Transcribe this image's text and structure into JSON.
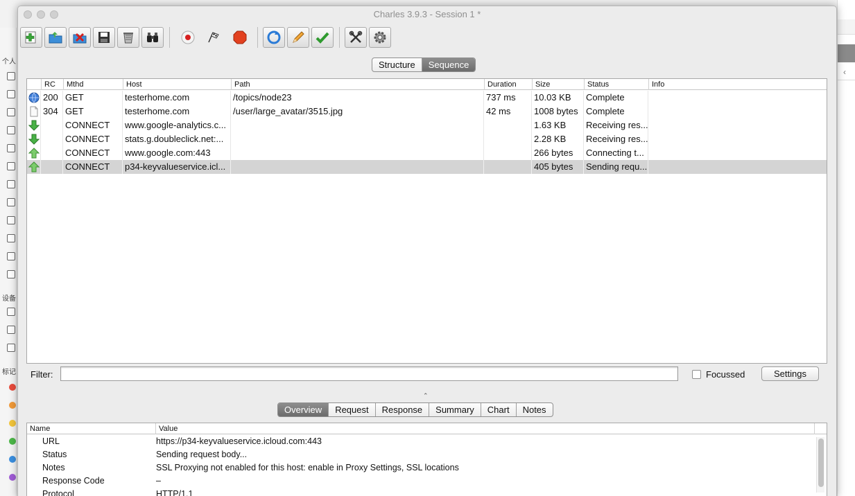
{
  "background": {
    "labels": [
      "个人",
      "设备",
      "标记"
    ],
    "tag_colors": [
      "#e94b3c",
      "#f19a38",
      "#f3c63b",
      "#4cb848",
      "#3b8fe0",
      "#a05cd6"
    ]
  },
  "window": {
    "title": "Charles 3.9.3 - Session 1 *"
  },
  "toolbar": {
    "buttons": [
      {
        "name": "new-session-icon"
      },
      {
        "name": "open-session-icon"
      },
      {
        "name": "close-session-icon"
      },
      {
        "name": "save-session-icon"
      },
      {
        "name": "clear-session-icon"
      },
      {
        "name": "find-icon"
      },
      {
        "name": "record-icon"
      },
      {
        "name": "throttle-icon"
      },
      {
        "name": "stop-icon"
      },
      {
        "name": "repeat-icon"
      },
      {
        "name": "edit-icon"
      },
      {
        "name": "validate-icon"
      },
      {
        "name": "tools-icon"
      },
      {
        "name": "settings-gear-icon"
      }
    ]
  },
  "view_tabs": {
    "structure": "Structure",
    "sequence": "Sequence",
    "active": "Sequence"
  },
  "table": {
    "columns": [
      "RC",
      "Mthd",
      "Host",
      "Path",
      "Duration",
      "Size",
      "Status",
      "Info"
    ],
    "rows": [
      {
        "icon": "globe",
        "rc": "200",
        "method": "GET",
        "host": "testerhome.com",
        "path": "/topics/node23",
        "duration": "737 ms",
        "size": "10.03 KB",
        "status": "Complete",
        "info": ""
      },
      {
        "icon": "document",
        "rc": "304",
        "method": "GET",
        "host": "testerhome.com",
        "path": "/user/large_avatar/3515.jpg",
        "duration": "42 ms",
        "size": "1008 bytes",
        "status": "Complete",
        "info": ""
      },
      {
        "icon": "arrow-down",
        "rc": "",
        "method": "CONNECT",
        "host": "www.google-analytics.c...",
        "path": "",
        "duration": "",
        "size": "1.63 KB",
        "status": "Receiving res...",
        "info": ""
      },
      {
        "icon": "arrow-down",
        "rc": "",
        "method": "CONNECT",
        "host": "stats.g.doubleclick.net:...",
        "path": "",
        "duration": "",
        "size": "2.28 KB",
        "status": "Receiving res...",
        "info": ""
      },
      {
        "icon": "arrow-up",
        "rc": "",
        "method": "CONNECT",
        "host": "www.google.com:443",
        "path": "",
        "duration": "",
        "size": "266 bytes",
        "status": "Connecting t...",
        "info": ""
      },
      {
        "icon": "arrow-up",
        "rc": "",
        "method": "CONNECT",
        "host": "p34-keyvalueservice.icl...",
        "path": "",
        "duration": "",
        "size": "405 bytes",
        "status": "Sending requ...",
        "info": "",
        "selected": true
      }
    ]
  },
  "filter": {
    "label": "Filter:",
    "value": "",
    "focussed_label": "Focussed",
    "settings_label": "Settings"
  },
  "detail_tabs": {
    "tabs": [
      "Overview",
      "Request",
      "Response",
      "Summary",
      "Chart",
      "Notes"
    ],
    "active": "Overview"
  },
  "detail": {
    "columns": [
      "Name",
      "Value"
    ],
    "rows": [
      {
        "name": "URL",
        "value": "https://p34-keyvalueservice.icloud.com:443"
      },
      {
        "name": "Status",
        "value": "Sending request body..."
      },
      {
        "name": "Notes",
        "value": "SSL Proxying not enabled for this host: enable in Proxy Settings, SSL locations"
      },
      {
        "name": "Response Code",
        "value": "–"
      },
      {
        "name": "Protocol",
        "value": "HTTP/1.1"
      }
    ]
  }
}
